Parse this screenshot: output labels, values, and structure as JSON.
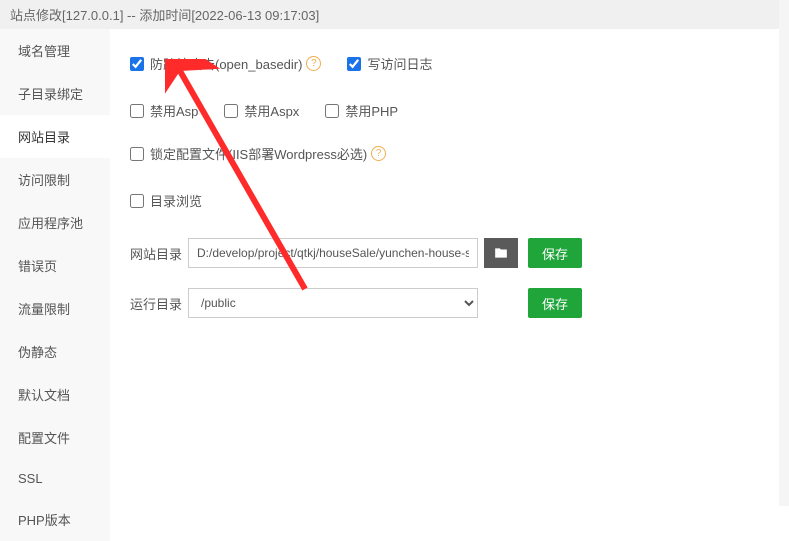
{
  "header": {
    "title": "站点修改[127.0.0.1] -- 添加时间[2022-06-13 09:17:03]"
  },
  "sidebar": {
    "items": [
      {
        "label": "域名管理"
      },
      {
        "label": "子目录绑定"
      },
      {
        "label": "网站目录"
      },
      {
        "label": "访问限制"
      },
      {
        "label": "应用程序池"
      },
      {
        "label": "错误页"
      },
      {
        "label": "流量限制"
      },
      {
        "label": "伪静态"
      },
      {
        "label": "默认文档"
      },
      {
        "label": "配置文件"
      },
      {
        "label": "SSL"
      },
      {
        "label": "PHP版本"
      }
    ],
    "active_index": 2
  },
  "checkboxes": {
    "anti_cross_site": {
      "label": "防跨站攻击(open_basedir)",
      "checked": true,
      "has_help": true
    },
    "write_access_log": {
      "label": "写访问日志",
      "checked": true
    },
    "disable_asp": {
      "label": "禁用Asp",
      "checked": false
    },
    "disable_aspx": {
      "label": "禁用Aspx",
      "checked": false
    },
    "disable_php": {
      "label": "禁用PHP",
      "checked": false
    },
    "lock_config": {
      "label": "锁定配置文件(IIS部署Wordpress必选)",
      "checked": false,
      "has_help": true
    },
    "dir_browse": {
      "label": "目录浏览",
      "checked": false
    }
  },
  "fields": {
    "site_dir": {
      "label": "网站目录",
      "value": "D:/develop/project/qtkj/houseSale/yunchen-house-sa",
      "save": "保存"
    },
    "run_dir": {
      "label": "运行目录",
      "value": "/public",
      "save": "保存"
    }
  },
  "icons": {
    "help": "?"
  },
  "colors": {
    "primary_blue": "#1a73e8",
    "save_green": "#20a53a",
    "help_orange": "#f0ad4e",
    "arrow_red": "#ff2a2a"
  }
}
